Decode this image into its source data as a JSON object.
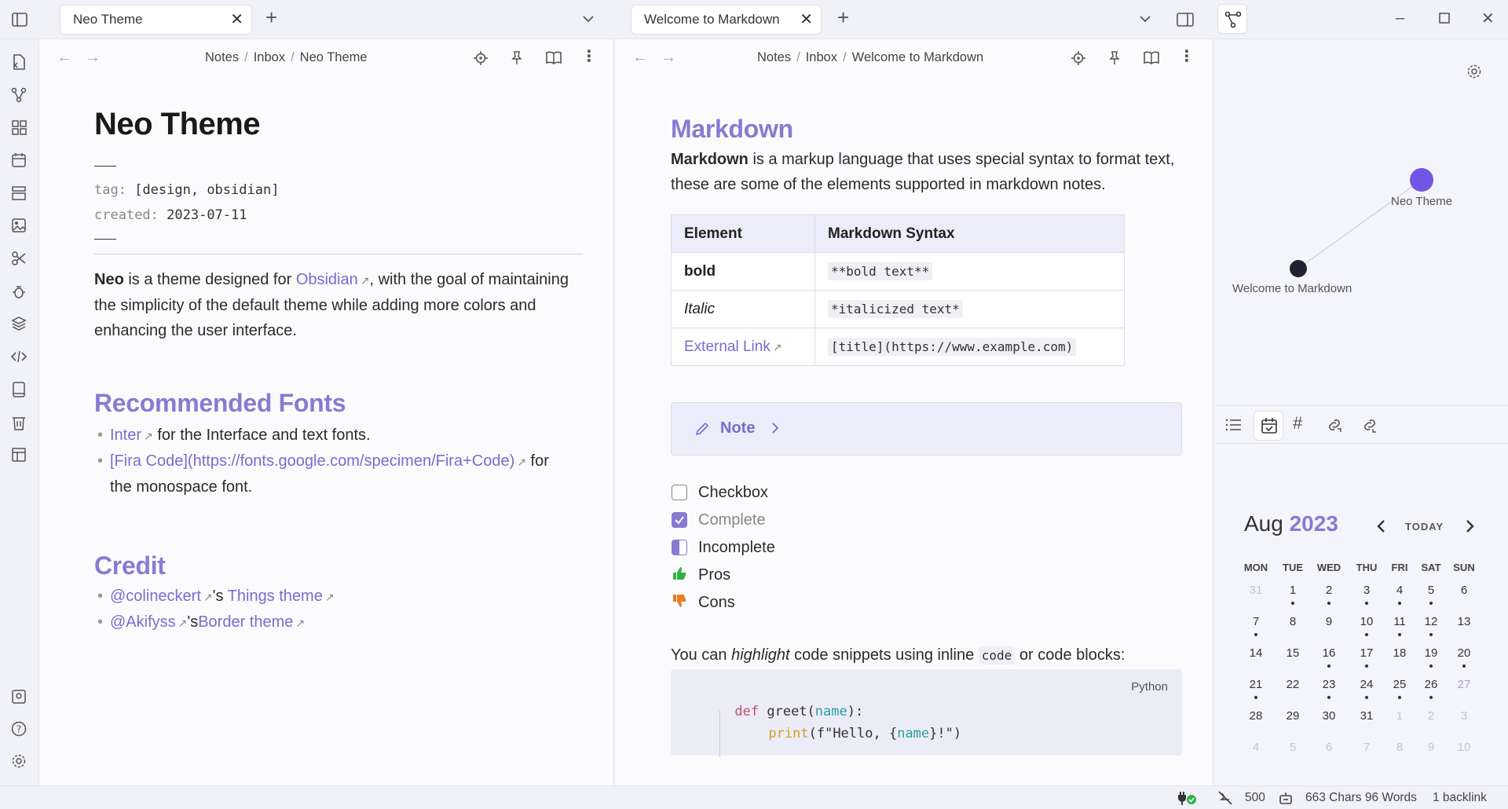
{
  "tabs": {
    "left": {
      "title": "Neo Theme"
    },
    "mid": {
      "title": "Welcome to Markdown"
    }
  },
  "left": {
    "breadcrumb": [
      "Notes",
      "Inbox",
      "Neo Theme"
    ],
    "title": "Neo Theme",
    "props": {
      "tag_key": "tag:",
      "tag_val": "[design, obsidian]",
      "created_key": "created:",
      "created_val": "2023-07-11"
    },
    "intro": {
      "bold": "Neo",
      "pre": " is a theme designed for ",
      "link": "Obsidian",
      "post": ", with the goal of maintaining the simplicity of the default theme while adding more colors and enhancing the user interface."
    },
    "fonts_heading": "Recommended Fonts",
    "fonts": [
      {
        "link": "Inter",
        "text": "for the Interface and text fonts."
      },
      {
        "link": "[Fira Code](https://fonts.google.com/specimen/Fira+Code)",
        "text": "for the monospace font."
      }
    ],
    "credit_heading": "Credit",
    "credits": [
      {
        "a": "@colineckert",
        "mid": "'s ",
        "b": "Things theme"
      },
      {
        "a": "@Akifyss",
        "mid": "'s",
        "b": "Border theme"
      }
    ]
  },
  "mid": {
    "breadcrumb": [
      "Notes",
      "Inbox",
      "Welcome to Markdown"
    ],
    "title": "Markdown",
    "intro_bold": "Markdown",
    "intro_rest": " is a markup language that uses special syntax to format text, these are some of the elements supported in markdown notes.",
    "table": {
      "headers": [
        "Element",
        "Markdown Syntax"
      ],
      "rows": [
        {
          "el": "bold",
          "syntax": "**bold text**"
        },
        {
          "el": "Italic",
          "syntax": "*italicized text*"
        },
        {
          "el": "External Link",
          "syntax": "[title](https://www.example.com)"
        }
      ]
    },
    "callout": "Note",
    "tasks": [
      "Checkbox",
      "Complete",
      "Incomplete",
      "Pros",
      "Cons"
    ],
    "highlight": {
      "pre": "You can ",
      "em": "highlight",
      "mid": " code snippets using inline ",
      "code": "code",
      "post": " or code blocks:"
    },
    "code": {
      "lang": "Python",
      "line1_kw": "def",
      "line1_fn": " greet(",
      "line1_arg": "name",
      "line1_end": "):",
      "line2_fn": "print",
      "line2_a": "(f\"Hello, {",
      "line2_arg": "name",
      "line2_b": "}!\")"
    }
  },
  "graph": {
    "nodes": [
      "Neo Theme",
      "Welcome to Markdown"
    ]
  },
  "calendar": {
    "month": "Aug",
    "year": "2023",
    "today_label": "TODAY",
    "weekdays": [
      "MON",
      "TUE",
      "WED",
      "THU",
      "FRI",
      "SAT",
      "SUN"
    ],
    "weeks": [
      [
        [
          "31",
          0,
          0
        ],
        [
          "1",
          1,
          1
        ],
        [
          "2",
          1,
          1
        ],
        [
          "3",
          1,
          1
        ],
        [
          "4",
          1,
          1
        ],
        [
          "5",
          1,
          1
        ],
        [
          "6",
          1,
          0
        ]
      ],
      [
        [
          "7",
          1,
          1
        ],
        [
          "8",
          1,
          0
        ],
        [
          "9",
          1,
          0
        ],
        [
          "10",
          1,
          1
        ],
        [
          "11",
          1,
          1
        ],
        [
          "12",
          1,
          1
        ],
        [
          "13",
          1,
          0
        ]
      ],
      [
        [
          "14",
          1,
          0
        ],
        [
          "15",
          1,
          0
        ],
        [
          "16",
          1,
          1
        ],
        [
          "17",
          1,
          1
        ],
        [
          "18",
          1,
          0
        ],
        [
          "19",
          1,
          1
        ],
        [
          "20",
          1,
          1
        ]
      ],
      [
        [
          "21",
          1,
          1
        ],
        [
          "22",
          1,
          0
        ],
        [
          "23",
          1,
          1
        ],
        [
          "24",
          1,
          1
        ],
        [
          "25",
          1,
          1
        ],
        [
          "26",
          1,
          1
        ],
        [
          "27",
          2,
          0
        ]
      ],
      [
        [
          "28",
          1,
          0
        ],
        [
          "29",
          1,
          0
        ],
        [
          "30",
          1,
          0
        ],
        [
          "31",
          1,
          0
        ],
        [
          "1",
          0,
          0
        ],
        [
          "2",
          0,
          0
        ],
        [
          "3",
          0,
          0
        ]
      ],
      [
        [
          "4",
          0,
          0
        ],
        [
          "5",
          0,
          0
        ],
        [
          "6",
          0,
          0
        ],
        [
          "7",
          0,
          0
        ],
        [
          "8",
          0,
          0
        ],
        [
          "9",
          0,
          0
        ],
        [
          "10",
          0,
          0
        ]
      ]
    ]
  },
  "status": {
    "count": "500",
    "chars_words": "663 Chars 96 Words",
    "backlinks": "1 backlink"
  },
  "colors": {
    "accent": "#7a6bd0",
    "node_active": "#7055e6",
    "node_default": "#222233",
    "pros": "#2fb344",
    "cons": "#e67e22"
  }
}
